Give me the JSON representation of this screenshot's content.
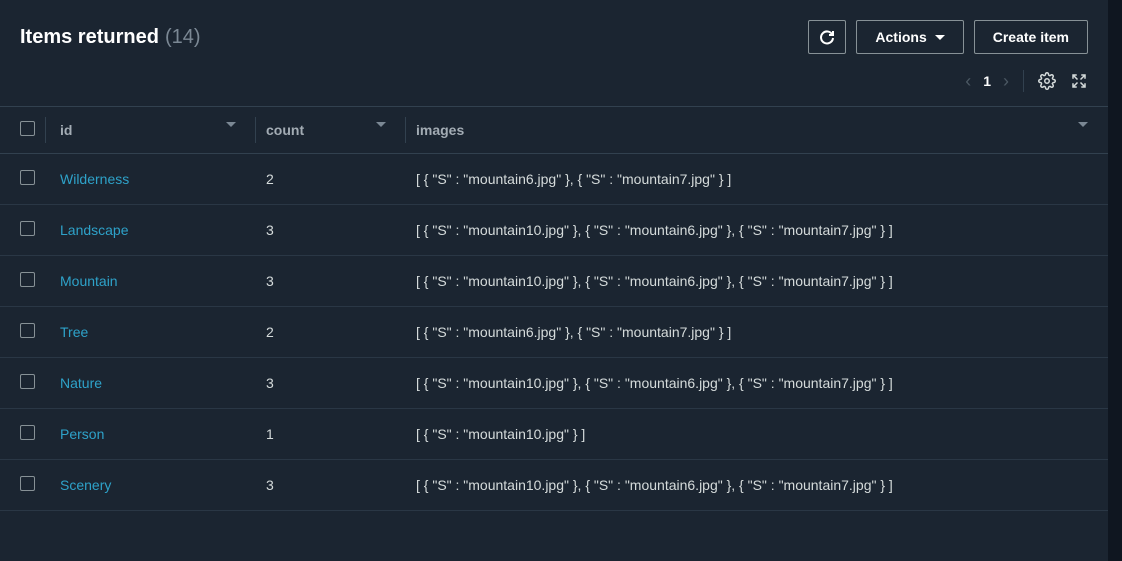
{
  "header": {
    "title": "Items returned",
    "count_label": "(14)",
    "refresh_aria": "Refresh",
    "actions_label": "Actions",
    "create_label": "Create item"
  },
  "pagination": {
    "page": "1"
  },
  "columns": {
    "id": "id",
    "count": "count",
    "images": "images"
  },
  "rows": [
    {
      "id": "Wilderness",
      "count": "2",
      "images": "[ { \"S\" : \"mountain6.jpg\" }, { \"S\" : \"mountain7.jpg\" } ]"
    },
    {
      "id": "Landscape",
      "count": "3",
      "images": "[ { \"S\" : \"mountain10.jpg\" }, { \"S\" : \"mountain6.jpg\" }, { \"S\" : \"mountain7.jpg\" } ]"
    },
    {
      "id": "Mountain",
      "count": "3",
      "images": "[ { \"S\" : \"mountain10.jpg\" }, { \"S\" : \"mountain6.jpg\" }, { \"S\" : \"mountain7.jpg\" } ]"
    },
    {
      "id": "Tree",
      "count": "2",
      "images": "[ { \"S\" : \"mountain6.jpg\" }, { \"S\" : \"mountain7.jpg\" } ]"
    },
    {
      "id": "Nature",
      "count": "3",
      "images": "[ { \"S\" : \"mountain10.jpg\" }, { \"S\" : \"mountain6.jpg\" }, { \"S\" : \"mountain7.jpg\" } ]"
    },
    {
      "id": "Person",
      "count": "1",
      "images": "[ { \"S\" : \"mountain10.jpg\" } ]"
    },
    {
      "id": "Scenery",
      "count": "3",
      "images": "[ { \"S\" : \"mountain10.jpg\" }, { \"S\" : \"mountain6.jpg\" }, { \"S\" : \"mountain7.jpg\" } ]"
    }
  ]
}
